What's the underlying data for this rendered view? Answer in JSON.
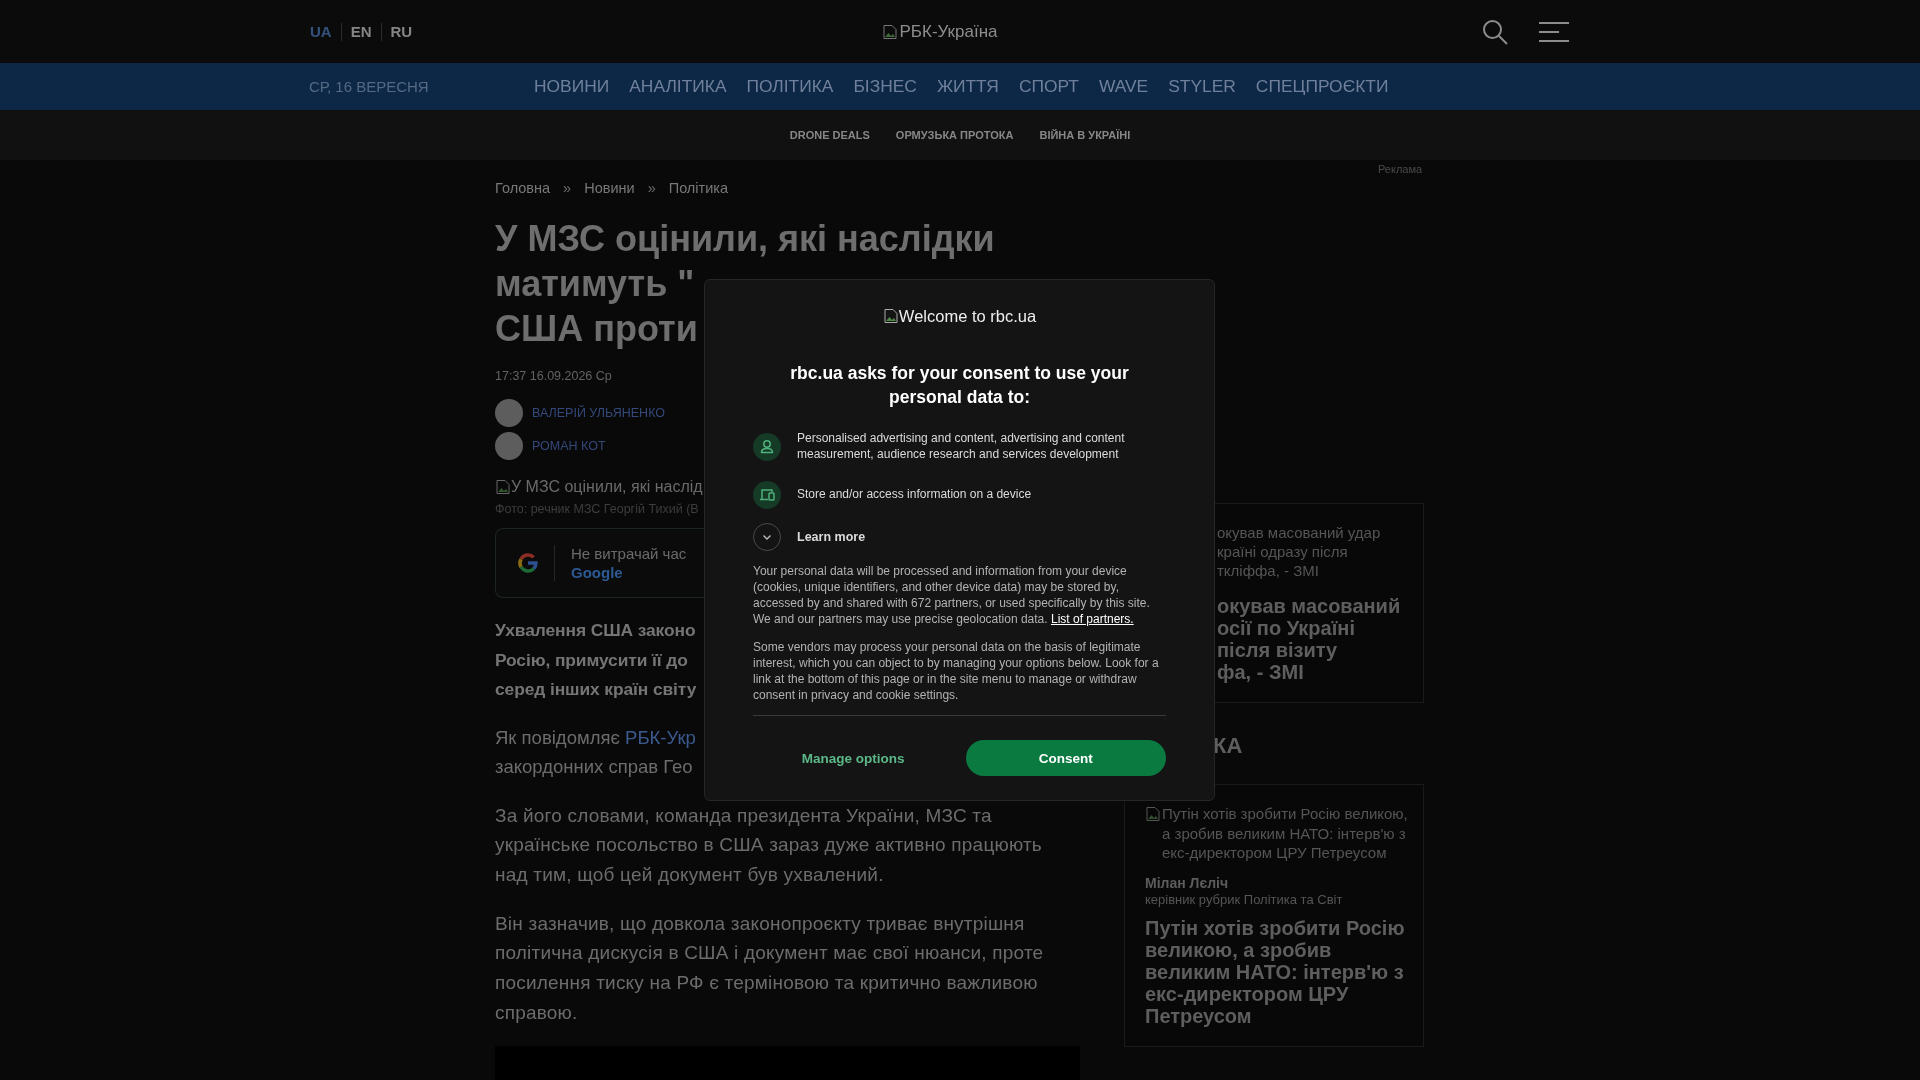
{
  "header": {
    "languages": [
      {
        "label": "UA",
        "selected": true
      },
      {
        "label": "EN",
        "selected": false
      },
      {
        "label": "RU",
        "selected": false
      }
    ],
    "logo_alt": "РБК-Україна"
  },
  "nav": {
    "date": "СР, 16 ВЕРЕСНЯ",
    "items": [
      "НОВИНИ",
      "АНАЛІТИКА",
      "ПОЛІТИКА",
      "БІЗНЕС",
      "ЖИТТЯ",
      "СПОРТ",
      "WAVE",
      "STYLER",
      "СПЕЦПРОЄКТИ"
    ]
  },
  "subnav": [
    "DRONE DEALS",
    "ОРМУЗЬКА ПРОТОКА",
    "ВІЙНА В УКРАЇНІ"
  ],
  "breadcrumbs": [
    {
      "text": "Головна",
      "separator": "»"
    },
    {
      "text": "Новини",
      "separator": "»"
    },
    {
      "text": "Політика"
    }
  ],
  "article": {
    "title_lines": [
      "У МЗС оцінили, які наслідки",
      "матимуть \"",
      "США проти"
    ],
    "timestamp": "17:37 16.09.2026 Ср",
    "authors": [
      "ВАЛЕРІЙ УЛЬЯНЕНКО",
      "РОМАН КОТ"
    ],
    "image_alt": "У МЗС оцінили, які наслід",
    "photo_caption": "Фото: речник МЗС Георгій Тихий (В",
    "google_promo": {
      "text": "Не витрачай час",
      "link": "Google"
    },
    "blocks": [
      {
        "kind": "lead",
        "lines": [
          "Ухвалення США законо",
          "Росію, примусити її до",
          "серед інших країн світу"
        ]
      },
      {
        "kind": "lines",
        "lines": [
          {
            "text": "Як повідомляє",
            "link": "РБК-Укр"
          },
          {
            "text": "закордонних справ Гео"
          }
        ]
      },
      {
        "kind": "paragraph",
        "text": "За його словами, команда президента України, МЗС та українське посольство в США зараз дуже активно працюють над тим, щоб цей документ був ухвалений."
      },
      {
        "kind": "paragraph",
        "text": "Він зазначив, що довкола законопроєкту триває внутрішня політична дискусія в США і документ має свої нюанси, проте посилення тиску на РФ є терміновою та критично важливою справою."
      }
    ]
  },
  "sidebar": {
    "ad_label": "Реклама",
    "news_card": {
      "image_alt_lines": [
        "окував масований удар",
        "країні одразу після",
        "ткліффа, - ЗМІ"
      ],
      "title_lines": [
        "окував масований",
        "осії по Україні",
        "після візиту",
        "фа, - ЗМІ"
      ]
    },
    "section_title": "КА",
    "opinion_card": {
      "image_alt": "Путін хотів зробити Росію великою, а зробив великим НАТО: інтерв'ю з екс-директором ЦРУ Петреусом",
      "author": "Мілан Лєліч",
      "author_role": "керівник рубрик Політика та Світ",
      "title": "Путін хотів зробити Росію великою, а зробив великим НАТО: інтерв'ю з екс-директором ЦРУ Петреусом"
    }
  },
  "consent_dialog": {
    "logo_alt": "Welcome to rbc.ua",
    "heading": "rbc.ua asks for your consent to use your personal data to:",
    "purposes": [
      {
        "kind": "person",
        "text": "Personalised advertising and content, advertising and content measurement, audience research and services development"
      },
      {
        "kind": "device",
        "text": "Store and/or access information on a device"
      }
    ],
    "learn_more": {
      "label": "Learn more",
      "expanded": false
    },
    "paragraphs": [
      {
        "text": "Your personal data will be processed and information from your device (cookies, unique identifiers, and other device data) may be stored by, accessed by and shared with 672 partners, or used specifically by this site. We and our partners may use precise geolocation data.",
        "link": "List of partners."
      },
      {
        "text": "Some vendors may process your personal data on the basis of legitimate interest, which you can object to by managing your options below. Look for a link at the bottom of this page or in the site menu to manage or withdraw consent in privacy and cookie settings."
      }
    ],
    "buttons": [
      {
        "kind": "secondary",
        "label": "Manage options"
      },
      {
        "kind": "primary",
        "label": "Consent"
      }
    ]
  }
}
